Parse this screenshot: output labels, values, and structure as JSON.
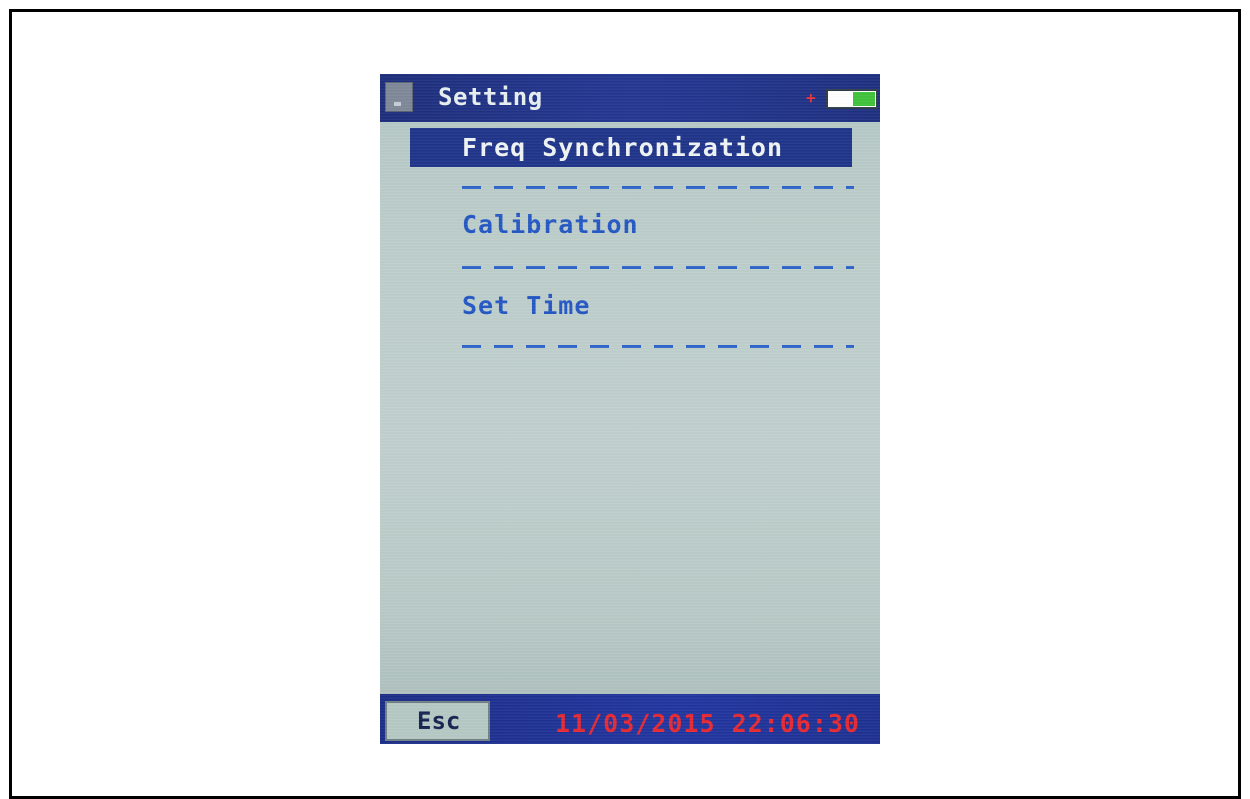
{
  "header": {
    "title": "Setting",
    "icon": "device-icon",
    "charging_indicator": "+",
    "battery_level": 0.45,
    "battery_color": "#3fc23a"
  },
  "menu": {
    "items": [
      {
        "label": "Freq Synchronization",
        "selected": true
      },
      {
        "label": "Calibration",
        "selected": false
      },
      {
        "label": "Set Time",
        "selected": false
      }
    ]
  },
  "footer": {
    "esc_label": "Esc",
    "datetime": "11/03/2015 22:06:30"
  },
  "colors": {
    "bar": "#1f3489",
    "menu_text": "#2457c4",
    "datetime_text": "#e52832"
  }
}
